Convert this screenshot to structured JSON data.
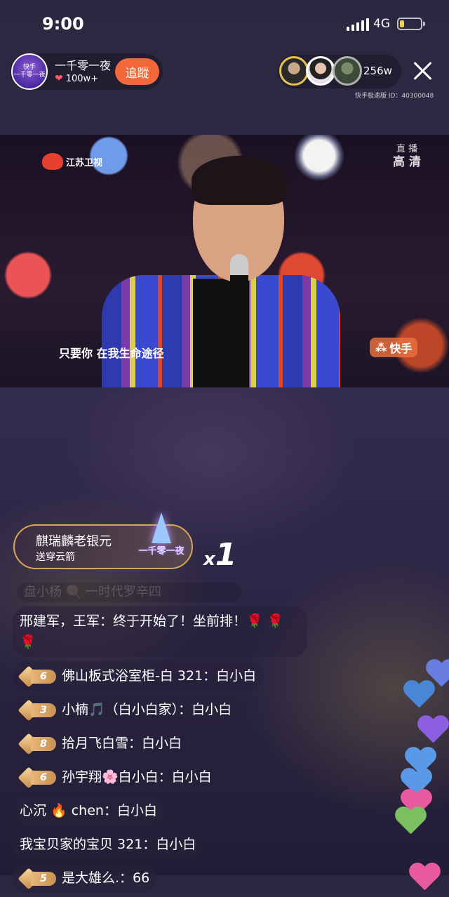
{
  "status_bar": {
    "time": "9:00",
    "network": "4G",
    "battery_level": 0.2
  },
  "host": {
    "avatar_text": [
      "快手",
      "一千零一夜"
    ],
    "name": "一千零一夜",
    "likes": "100w+",
    "follow_label": "追蹤"
  },
  "viewers": {
    "count": "256w"
  },
  "app_id_text": "快手极速版 ID：40300048",
  "video": {
    "channel_logo": "江苏卫视",
    "live_label": "直 播",
    "quality_label": "高 清",
    "lyric": "只要你 在我生命途径",
    "watermark": "快手"
  },
  "gift": {
    "sender": "麒瑞麟老银元",
    "action": "送穿云箭",
    "gift_label": "一千零一夜",
    "count_prefix": "x",
    "count": "1"
  },
  "chat": {
    "faded_line": "盘小杨 🍭 一时代罗辛四",
    "messages": [
      {
        "text": "邢建军，王军：终于开始了！坐前排！🌹 🌹 🌹",
        "level": null
      },
      {
        "text": "佛山板式浴室柜-白 321：白小白",
        "level": "6"
      },
      {
        "text": "小楠🎵（白小白家）：白小白",
        "level": "3"
      },
      {
        "text": "拾月飞白雪：白小白",
        "level": "8"
      },
      {
        "text": "孙宇翔🌸白小白：白小白",
        "level": "6"
      },
      {
        "text": "心沉 🔥 chen：白小白",
        "level": null
      },
      {
        "text": "我宝贝家的宝贝 321：白小白",
        "level": null
      },
      {
        "text": "是大雄么.：66",
        "level": "5"
      }
    ]
  },
  "colors": {
    "follow_button": "#f2683a",
    "gift_border": "#d9a55a",
    "level_badge": "#c9904f"
  }
}
